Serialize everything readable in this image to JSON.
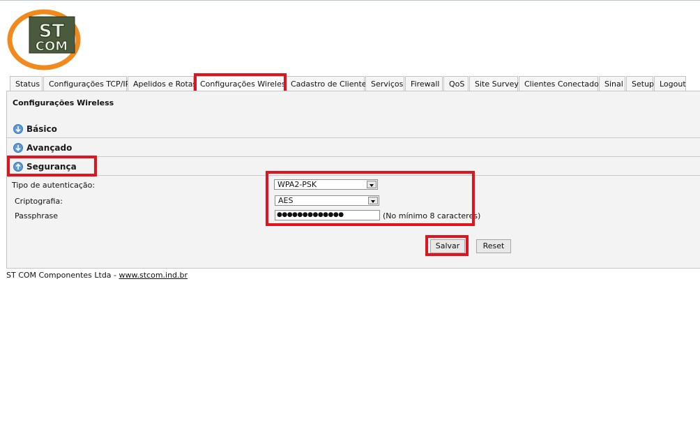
{
  "logo": {
    "line1": "ST",
    "line2": "COM"
  },
  "tabs": [
    {
      "label": "Status"
    },
    {
      "label": "Configurações TCP/IP"
    },
    {
      "label": "Apelidos e Rotas"
    },
    {
      "label": "Configurações Wireless"
    },
    {
      "label": "Cadastro de Clientes"
    },
    {
      "label": "Serviços"
    },
    {
      "label": "Firewall"
    },
    {
      "label": "QoS"
    },
    {
      "label": "Site Survey"
    },
    {
      "label": "Clientes Conectados"
    },
    {
      "label": "Sinal"
    },
    {
      "label": "Setup"
    },
    {
      "label": "Logout"
    }
  ],
  "panel": {
    "title": "Configurações Wireless",
    "sections": {
      "basico": "Básico",
      "avancado": "Avançado",
      "seguranca": "Segurança"
    }
  },
  "form": {
    "auth_label": "Tipo de autenticação:",
    "auth_value": "WPA2-PSK",
    "crypto_label": "Criptografia:",
    "crypto_value": "AES",
    "pass_label": "Passphrase",
    "pass_masked": "●●●●●●●●●●●●●",
    "pass_hint": "(No mínimo 8 caracteres)"
  },
  "buttons": {
    "save": "Salvar",
    "reset": "Reset"
  },
  "footer": {
    "company": "ST COM Componentes Ltda - ",
    "link": "www.stcom.ind.br"
  },
  "colors": {
    "highlight": "#e0141e",
    "logo_orange": "#f08a1c",
    "logo_green": "#4a5a3c"
  }
}
